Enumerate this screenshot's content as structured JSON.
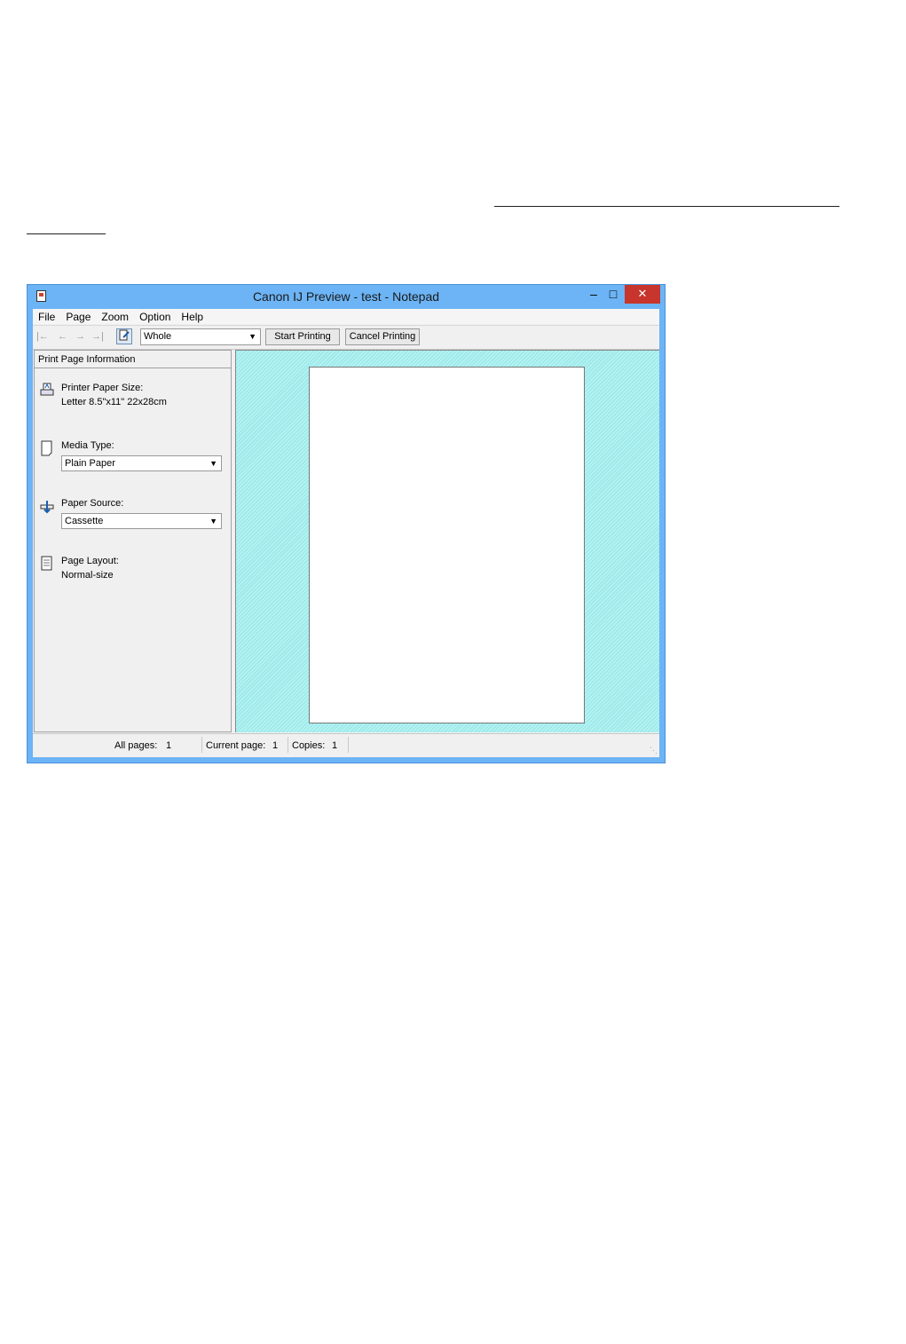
{
  "window": {
    "title": "Canon IJ Preview - test - Notepad",
    "minimize": "–",
    "maximize": "□",
    "close": "✕"
  },
  "menu": [
    "File",
    "Page",
    "Zoom",
    "Option",
    "Help"
  ],
  "toolbar": {
    "first_page": "|←",
    "prev_page": "←",
    "next_page": "→",
    "last_page": "→|",
    "zoom_value": "Whole",
    "start_printing": "Start Printing",
    "cancel_printing": "Cancel Printing"
  },
  "sidebar": {
    "header": "Print Page Information",
    "printer_paper_size_label": "Printer Paper Size:",
    "printer_paper_size_value": "Letter 8.5\"x11\" 22x28cm",
    "media_type_label": "Media Type:",
    "media_type_value": "Plain Paper",
    "paper_source_label": "Paper Source:",
    "paper_source_value": "Cassette",
    "page_layout_label": "Page Layout:",
    "page_layout_value": "Normal-size"
  },
  "status": {
    "all_pages_label": "All pages:",
    "all_pages_value": "1",
    "current_page_label": "Current page:",
    "current_page_value": "1",
    "copies_label": "Copies:",
    "copies_value": "1"
  },
  "colors": {
    "title_bar": "#6cb4f5",
    "close_button": "#c7352c",
    "preview_background": "#aaf2f2"
  }
}
